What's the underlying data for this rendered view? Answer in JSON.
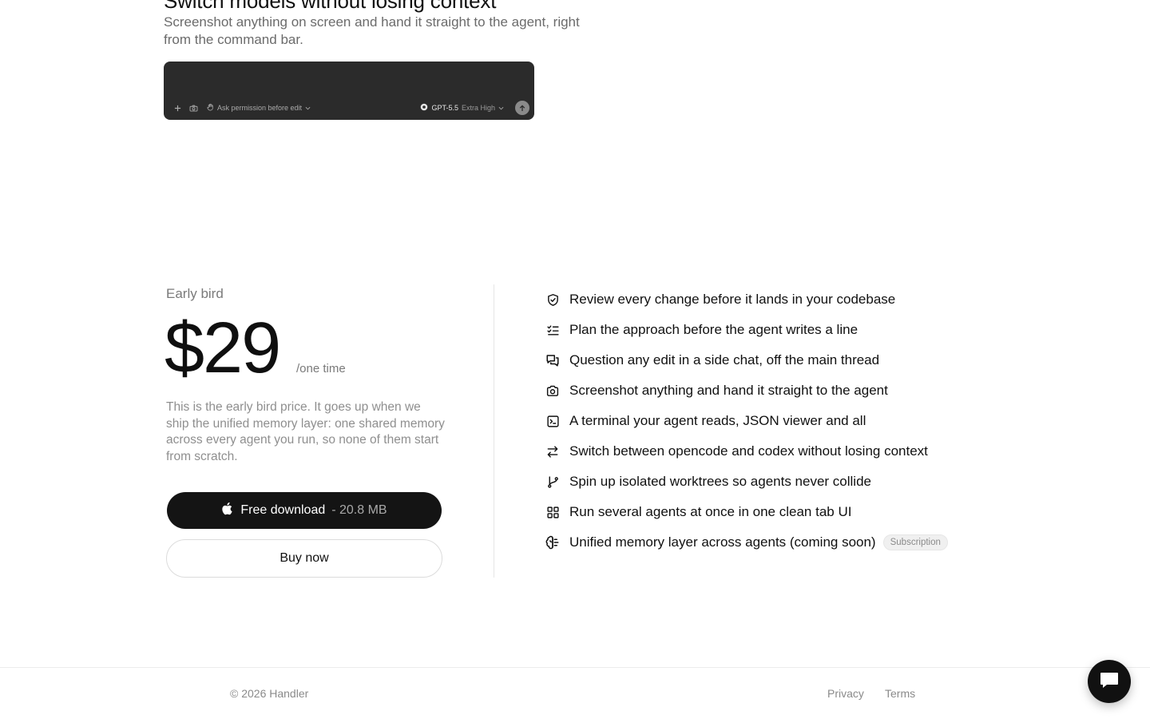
{
  "hero": {
    "title": "Switch models without losing context",
    "subtitle": "Screenshot anything on screen and hand it straight to the agent, right from the command bar."
  },
  "command_bar": {
    "icons": [
      "plus-icon",
      "camera-icon",
      "hand-icon",
      "chevron-down-icon",
      "model-icon",
      "arrow-up-icon"
    ],
    "permission_label": "Ask permission before edit",
    "model_name": "GPT-5.5",
    "model_level": "Extra High"
  },
  "pricing": {
    "tier_label": "Early bird",
    "price": "$29",
    "period": "/one time",
    "description": "This is the early bird price. It goes up when we ship the unified memory layer: one shared memory across every agent you run, so none of them start from scratch.",
    "download_label": "Free download",
    "download_size": "- 20.8 MB",
    "download_icon": "apple-icon",
    "buy_label": "Buy now"
  },
  "features": [
    {
      "icon": "shield-check-icon",
      "text": "Review every change before it lands in your codebase"
    },
    {
      "icon": "checklist-icon",
      "text": "Plan the approach before the agent writes a line"
    },
    {
      "icon": "chat-bubbles-icon",
      "text": "Question any edit in a side chat, off the main thread"
    },
    {
      "icon": "camera-icon",
      "text": "Screenshot anything and hand it straight to the agent"
    },
    {
      "icon": "terminal-icon",
      "text": "A terminal your agent reads, JSON viewer and all"
    },
    {
      "icon": "swap-arrows-icon",
      "text": "Switch between opencode and codex without losing context"
    },
    {
      "icon": "git-branch-icon",
      "text": "Spin up isolated worktrees so agents never collide"
    },
    {
      "icon": "grid-icon",
      "text": "Run several agents at once in one clean tab UI"
    },
    {
      "icon": "brain-icon",
      "text": "Unified memory layer across agents (coming soon)",
      "badge": "Subscription"
    }
  ],
  "footer": {
    "copyright": "© 2026 Handler",
    "privacy": "Privacy",
    "terms": "Terms"
  },
  "chat_widget": {
    "icon": "chat-icon"
  }
}
